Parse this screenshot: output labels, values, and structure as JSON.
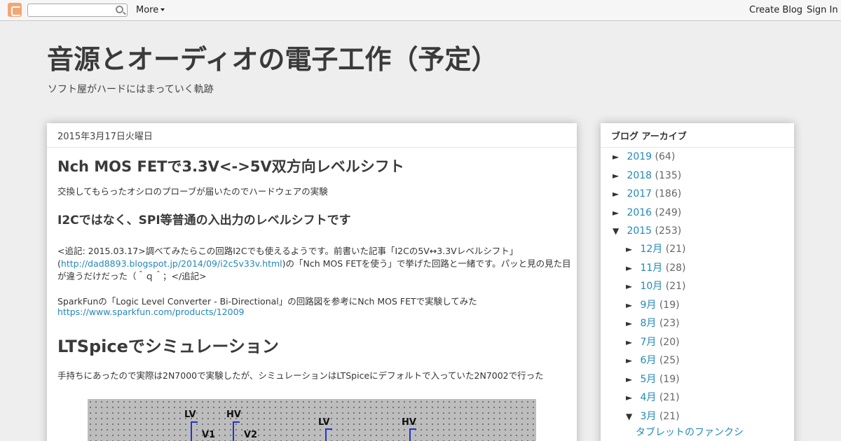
{
  "navbar": {
    "search_placeholder": "",
    "more_label": "More",
    "create_blog_label": "Create Blog",
    "sign_in_label": "Sign In"
  },
  "header": {
    "title": "音源とオーディオの電子工作（予定）",
    "description": "ソフト屋がハードにはまっていく軌跡"
  },
  "post": {
    "date": "2015年3月17日火曜日",
    "title": "Nch MOS FETで3.3V<->5V双方向レベルシフト",
    "intro": "交換してもらったオシロのプローブが届いたのでハードウェアの実験",
    "subheading": "I2Cではなく、SPI等普通の入出力のレベルシフトです",
    "note_line1": "<追記: 2015.03.17>調べてみたらこの回路I2Cでも使えるようです。前書いた記事「I2Cの5V↔3.3Vレベルシフト」",
    "note_line2_prefix": "(",
    "note_line2_link": "http://dad8893.blogspot.jp/2014/09/i2c5v33v.html",
    "note_line2_suffix": ")の「Nch MOS FETを使う」で挙げた回路と一緒です。パッと見の見た目",
    "note_line3": "が違うだけだった（＾ｑ＾；</追記>",
    "sparkfun_line": "SparkFunの「Logic Level Converter - Bi-Directional」の回路図を参考にNch MOS FETで実験してみた",
    "sparkfun_link": "https://www.sparkfun.com/products/12009",
    "section_heading": "LTSpiceでシミュレーション",
    "section_text": "手持ちにあったので実際は2N7000で実験したが、シミュレーションはLTSpiceにデフォルトで入っていた2N7002で行った",
    "schematic_labels": {
      "lv1": "LV",
      "hv1": "HV",
      "v1": "V1",
      "v2": "V2",
      "lv2": "LV",
      "hv2": "HV"
    }
  },
  "sidebar": {
    "title": "ブログ アーカイブ",
    "years": [
      {
        "toggle": "►",
        "label": "2019",
        "count": "(64)"
      },
      {
        "toggle": "►",
        "label": "2018",
        "count": "(135)"
      },
      {
        "toggle": "►",
        "label": "2017",
        "count": "(186)"
      },
      {
        "toggle": "►",
        "label": "2016",
        "count": "(249)"
      },
      {
        "toggle": "▼",
        "label": "2015",
        "count": "(253)"
      }
    ],
    "months": [
      {
        "toggle": "►",
        "label": "12月",
        "count": "(21)"
      },
      {
        "toggle": "►",
        "label": "11月",
        "count": "(28)"
      },
      {
        "toggle": "►",
        "label": "10月",
        "count": "(21)"
      },
      {
        "toggle": "►",
        "label": "9月",
        "count": "(19)"
      },
      {
        "toggle": "►",
        "label": "8月",
        "count": "(23)"
      },
      {
        "toggle": "►",
        "label": "7月",
        "count": "(20)"
      },
      {
        "toggle": "►",
        "label": "6月",
        "count": "(25)"
      },
      {
        "toggle": "►",
        "label": "5月",
        "count": "(19)"
      },
      {
        "toggle": "►",
        "label": "4月",
        "count": "(21)"
      },
      {
        "toggle": "▼",
        "label": "3月",
        "count": "(21)"
      }
    ],
    "post_title": "タブレットのファンクシ"
  }
}
